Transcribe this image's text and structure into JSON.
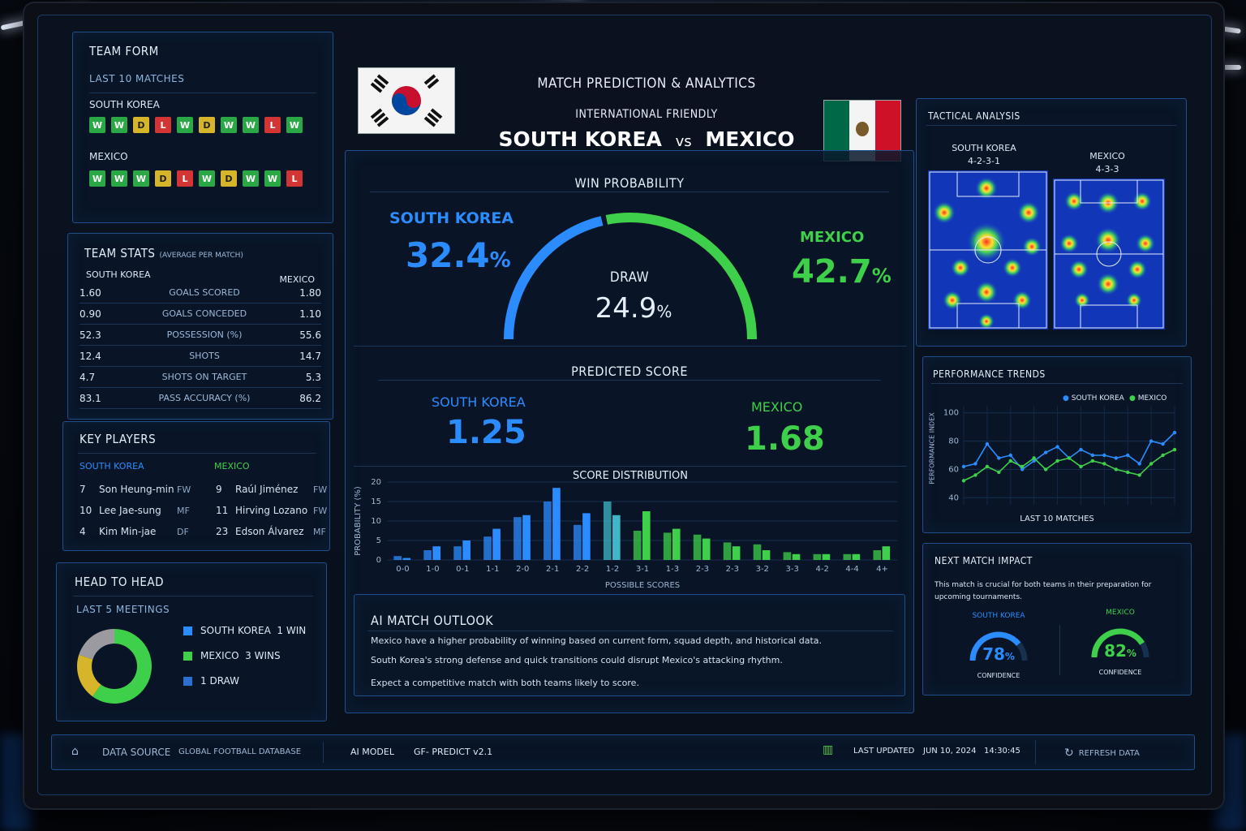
{
  "header": {
    "title": "MATCH PREDICTION & ANALYTICS",
    "competition": "INTERNATIONAL FRIENDLY",
    "home": "SOUTH KOREA",
    "vs": "vs",
    "away": "MEXICO"
  },
  "team_form": {
    "title": "TEAM FORM",
    "subtitle": "LAST 10 MATCHES",
    "home_label": "SOUTH KOREA",
    "away_label": "MEXICO",
    "home": [
      "W",
      "W",
      "D",
      "L",
      "W",
      "D",
      "W",
      "W",
      "L",
      "W"
    ],
    "away": [
      "W",
      "W",
      "W",
      "D",
      "L",
      "W",
      "D",
      "W",
      "W",
      "L"
    ]
  },
  "team_stats": {
    "title": "TEAM STATS",
    "subtitle": "(AVERAGE PER MATCH)",
    "home_label": "SOUTH KOREA",
    "away_label": "MEXICO",
    "rows": [
      {
        "label": "GOALS SCORED",
        "home": "1.60",
        "away": "1.80"
      },
      {
        "label": "GOALS CONCEDED",
        "home": "0.90",
        "away": "1.10"
      },
      {
        "label": "POSSESSION (%)",
        "home": "52.3",
        "away": "55.6"
      },
      {
        "label": "SHOTS",
        "home": "12.4",
        "away": "14.7"
      },
      {
        "label": "SHOTS ON TARGET",
        "home": "4.7",
        "away": "5.3"
      },
      {
        "label": "PASS ACCURACY (%)",
        "home": "83.1",
        "away": "86.2"
      }
    ]
  },
  "key_players": {
    "title": "KEY PLAYERS",
    "home_label": "SOUTH KOREA",
    "away_label": "MEXICO",
    "home": [
      {
        "num": "7",
        "name": "Son Heung-min",
        "pos": "FW"
      },
      {
        "num": "10",
        "name": "Lee Jae-sung",
        "pos": "MF"
      },
      {
        "num": "4",
        "name": "Kim Min-jae",
        "pos": "DF"
      }
    ],
    "away": [
      {
        "num": "9",
        "name": "Raúl Jiménez",
        "pos": "FW"
      },
      {
        "num": "11",
        "name": "Hirving Lozano",
        "pos": "FW"
      },
      {
        "num": "23",
        "name": "Edson Álvarez",
        "pos": "MF"
      }
    ]
  },
  "head_to_head": {
    "title": "HEAD TO HEAD",
    "subtitle": "LAST 5 MEETINGS",
    "legend": [
      {
        "label": "SOUTH KOREA  1 WIN",
        "value": 1,
        "color": "#2b8cff"
      },
      {
        "label": "MEXICO  3 WINS",
        "value": 3,
        "color": "#3ed04a"
      },
      {
        "label": "1 DRAW",
        "value": 1,
        "color": "#d6b52a"
      }
    ]
  },
  "win_probability": {
    "title": "WIN PROBABILITY",
    "home_label": "SOUTH KOREA",
    "home_value": "32.4",
    "draw_label": "DRAW",
    "draw_value": "24.9",
    "away_label": "MEXICO",
    "away_value": "42.7",
    "pct": "%",
    "home_color": "#2b8cff",
    "away_color": "#3ed04a"
  },
  "predicted_score": {
    "title": "PREDICTED SCORE",
    "home_label": "SOUTH KOREA",
    "home_value": "1.25",
    "away_label": "MEXICO",
    "away_value": "1.68"
  },
  "chart_data": {
    "type": "bar",
    "title": "SCORE DISTRIBUTION",
    "xlabel": "POSSIBLE SCORES",
    "ylabel": "PROBABILITY (%)",
    "ylim": [
      0,
      20
    ],
    "yticks": [
      0,
      5,
      10,
      15,
      20
    ],
    "categories": [
      "0-0",
      "1-0",
      "0-1",
      "1-1",
      "2-0",
      "2-1",
      "2-2",
      "1-2",
      "3-1",
      "1-3",
      "2-3",
      "2-3",
      "3-2",
      "3-3",
      "4-2",
      "4-4",
      "4+"
    ],
    "series": [
      {
        "values": [
          1,
          2.5,
          3.5,
          6,
          11,
          15,
          9,
          15,
          7.5,
          7,
          6.5,
          4.5,
          4,
          2,
          1.5,
          1.5,
          2.5
        ]
      },
      {
        "values": [
          0.5,
          3.5,
          5,
          8,
          11.5,
          18.5,
          12,
          11.5,
          12.5,
          8,
          5.5,
          3.5,
          2.5,
          1.5,
          1.5,
          1.5,
          3.5
        ]
      }
    ]
  },
  "outlook": {
    "title": "AI MATCH OUTLOOK",
    "lines": [
      "Mexico have a higher probability of winning based on current form, squad depth, and historical data.",
      "South Korea's strong defense and quick transitions could disrupt Mexico's attacking rhythm.",
      "Expect a competitive match with both teams likely to score."
    ]
  },
  "tactical": {
    "title": "TACTICAL ANALYSIS",
    "home_label": "SOUTH KOREA",
    "home_formation": "4-2-3-1",
    "away_label": "MEXICO",
    "away_formation": "4-3-3"
  },
  "trends": {
    "title": "PERFORMANCE TRENDS",
    "ylabel": "PERFORMANCE INDEX",
    "xlabel": "LAST 10 MATCHES",
    "legend_home": "SOUTH KOREA",
    "legend_away": "MEXICO",
    "yticks": [
      "100",
      "80",
      "60",
      "40"
    ],
    "home": [
      62,
      64,
      78,
      68,
      70,
      60,
      66,
      72,
      76,
      68,
      74,
      70,
      70,
      68,
      70,
      64,
      80,
      78,
      86
    ],
    "away": [
      52,
      56,
      62,
      58,
      66,
      62,
      68,
      60,
      66,
      68,
      62,
      66,
      64,
      60,
      58,
      56,
      64,
      70,
      74
    ]
  },
  "impact": {
    "title": "NEXT MATCH IMPACT",
    "text": "This match is crucial for both teams in their preparation for upcoming tournaments.",
    "home_label": "SOUTH KOREA",
    "home_value": "78",
    "away_label": "MEXICO",
    "away_value": "82",
    "pct": "%",
    "confidence": "CONFIDENCE"
  },
  "footer": {
    "source_label": "DATA SOURCE",
    "source_value": "GLOBAL FOOTBALL DATABASE",
    "model_label": "AI MODEL",
    "model_value": "GF- PREDICT v2.1",
    "updated_label": "LAST UPDATED",
    "updated_value": "JUN 10, 2024   14:30:45",
    "refresh": "REFRESH DATA"
  }
}
